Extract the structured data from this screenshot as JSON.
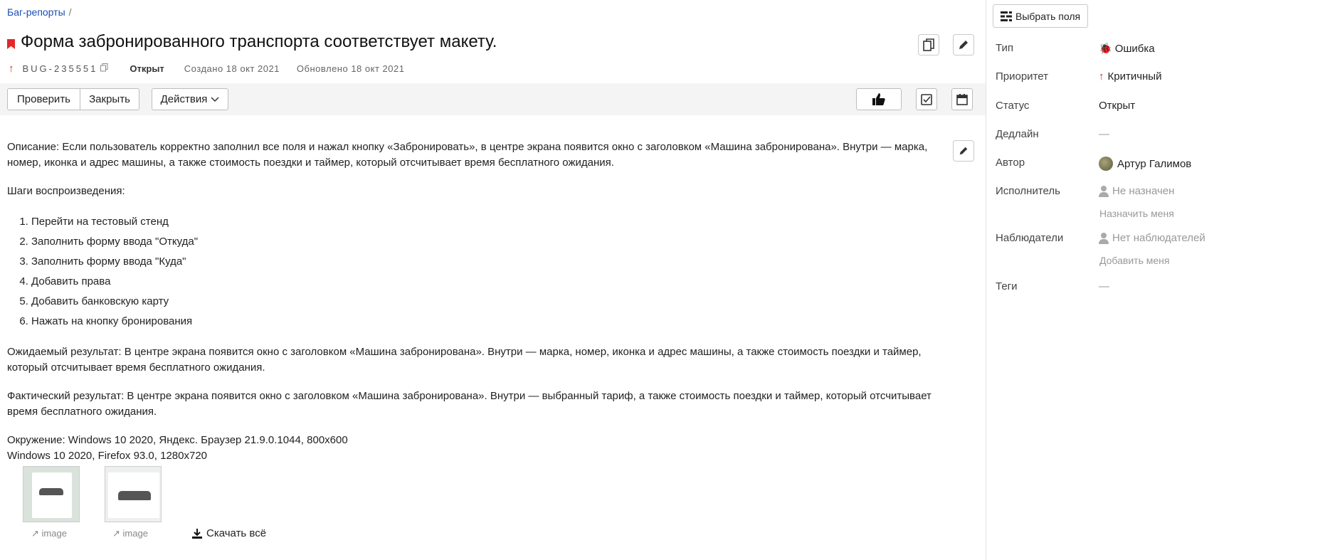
{
  "breadcrumb": {
    "parent": "Баг-репорты",
    "separator": "/"
  },
  "issue": {
    "title": "Форма забронированного транспорта соответствует макету.",
    "key": "BUG-235551",
    "status": "Открыт",
    "created": "Создано 18 окт 2021",
    "updated": "Обновлено 18 окт 2021",
    "priority_color": "#e5262a"
  },
  "toolbar": {
    "check_label": "Проверить",
    "close_label": "Закрыть",
    "actions_label": "Действия"
  },
  "description": {
    "text": "Описание: Если пользователь корректно заполнил все поля и нажал кнопку «Забронировать», в центре экрана появится окно с заголовком «Машина забронирована». Внутри — марка, номер, иконка и адрес машины, а также стоимость поездки и таймер, который отсчитывает время бесплатного ожидания.",
    "steps_title": "Шаги воспроизведения:",
    "steps": [
      "Перейти на тестовый стенд",
      "Заполнить форму ввода \"Откуда\"",
      "Заполнить форму ввода \"Куда\"",
      "Добавить права",
      "Добавить банковскую карту",
      "Нажать на кнопку бронирования"
    ],
    "expected": "Ожидаемый результат: В центре экрана появится окно с заголовком «Машина забронирована». Внутри — марка, номер, иконка и адрес машины, а также стоимость поездки и таймер, который отсчитывает время бесплатного ожидания.",
    "actual": "Фактический результат: В центре экрана появится окно с заголовком «Машина забронирована». Внутри — выбранный тариф, а также стоимость поездки и таймер, который отсчитывает время бесплатного ожидания.",
    "env_line1": "Окружение: Windows 10 2020, Яндекс. Браузер 21.9.0.1044, 800x600",
    "env_line2": "Windows 10 2020, Firefox 93.0, 1280x720"
  },
  "attachments": [
    {
      "label": "image"
    },
    {
      "label": "image"
    }
  ],
  "download_all": "Скачать всё",
  "sidebar": {
    "choose_fields": "Выбрать поля",
    "type_label": "Тип",
    "type_value": "Ошибка",
    "priority_label": "Приоритет",
    "priority_value": "Критичный",
    "status_label": "Статус",
    "status_value": "Открыт",
    "deadline_label": "Дедлайн",
    "deadline_value": "—",
    "author_label": "Автор",
    "author_value": "Артур Галимов",
    "assignee_label": "Исполнитель",
    "assignee_value": "Не назначен",
    "assign_me": "Назначить меня",
    "watchers_label": "Наблюдатели",
    "watchers_value": "Нет наблюдателей",
    "add_me": "Добавить меня",
    "tags_label": "Теги",
    "tags_value": "—"
  }
}
